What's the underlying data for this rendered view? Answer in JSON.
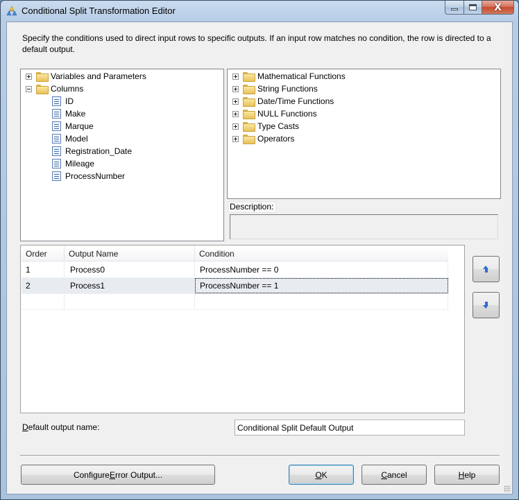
{
  "window": {
    "title": "Conditional Split Transformation Editor",
    "app_icon": "ssis-transform-icon",
    "caption_buttons": {
      "minimize": "minimize-icon",
      "maximize": "maximize-icon",
      "close": "close-icon",
      "close_glyph": "X"
    }
  },
  "instructions": "Specify the conditions used to direct input rows to specific outputs. If an input row matches no condition, the row is directed to a default output.",
  "left_tree": {
    "nodes": [
      {
        "label": "Variables and Parameters",
        "expanded": false,
        "icon": "folder-icon"
      },
      {
        "label": "Columns",
        "expanded": true,
        "icon": "folder-icon",
        "children": [
          "ID",
          "Make",
          "Marque",
          "Model",
          "Registration_Date",
          "Mileage",
          "ProcessNumber"
        ]
      }
    ]
  },
  "right_tree": {
    "nodes": [
      {
        "label": "Mathematical Functions",
        "expanded": false
      },
      {
        "label": "String Functions",
        "expanded": false
      },
      {
        "label": "Date/Time Functions",
        "expanded": false
      },
      {
        "label": "NULL Functions",
        "expanded": false
      },
      {
        "label": "Type Casts",
        "expanded": false
      },
      {
        "label": "Operators",
        "expanded": false
      }
    ]
  },
  "description": {
    "label": "Description:",
    "value": ""
  },
  "conditions_grid": {
    "columns": [
      "Order",
      "Output Name",
      "Condition"
    ],
    "rows": [
      {
        "order": "1",
        "output_name": "Process0",
        "condition": "ProcessNumber == 0",
        "selected": false
      },
      {
        "order": "2",
        "output_name": "Process1",
        "condition": "ProcessNumber == 1",
        "selected": true
      }
    ],
    "new_row": {
      "order": "",
      "output_name": "",
      "condition": ""
    }
  },
  "move_buttons": {
    "up_icon": "arrow-up-icon",
    "down_icon": "arrow-down-icon"
  },
  "default_output": {
    "label_mnemonic": "D",
    "label_rest": "efault output name:",
    "value": "Conditional Split Default Output"
  },
  "buttons": {
    "configure_error": {
      "pre": "Configure ",
      "mnemonic": "E",
      "post": "rror Output..."
    },
    "ok": {
      "pre": "",
      "mnemonic": "O",
      "post": "K"
    },
    "cancel": {
      "pre": "",
      "mnemonic": "C",
      "post": "ancel"
    },
    "help": {
      "pre": "",
      "mnemonic": "H",
      "post": "elp"
    }
  },
  "colors": {
    "title_bar": "#b7cde6",
    "client_bg": "#f0f0f0",
    "selected_row": "#e8ecf1",
    "arrow_blue": "#2f6fd1",
    "ok_border": "#3c7fb1"
  }
}
